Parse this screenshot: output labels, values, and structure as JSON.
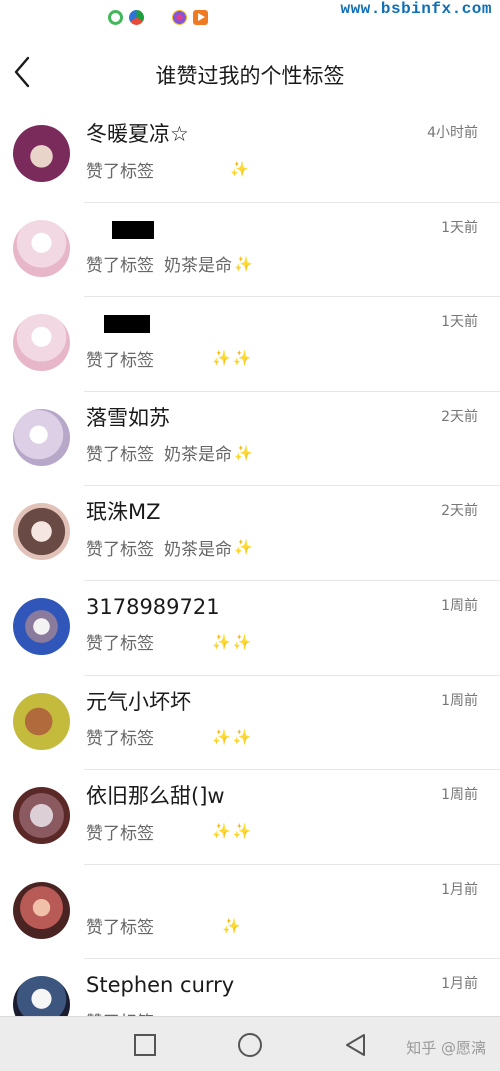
{
  "status_bar": {
    "icons": [
      "notification-app-icon",
      "browser-icon",
      "gallery-icon",
      "video-player-icon"
    ],
    "watermark": "www.bsbinfx.com"
  },
  "header": {
    "back_icon": "chevron-left-icon",
    "title": "谁赞过我的个性标签"
  },
  "list": {
    "prefix": "赞了标签",
    "sparkle": "✨",
    "items": [
      {
        "name": "冬暖夏凉☆",
        "tag": "",
        "time": "4小时前"
      },
      {
        "name": "",
        "tag": "奶茶是命",
        "time": "1天前"
      },
      {
        "name": "",
        "tag": "",
        "time": "1天前"
      },
      {
        "name": "落雪如苏",
        "tag": "奶茶是命",
        "time": "2天前"
      },
      {
        "name": "珉洙MZ",
        "tag": "奶茶是命",
        "time": "2天前"
      },
      {
        "name": "3178989721",
        "tag": "",
        "time": "1周前"
      },
      {
        "name": "元气小坏坏",
        "tag": "",
        "time": "1周前"
      },
      {
        "name": "依旧那么甜(]w",
        "tag": "",
        "time": "1周前"
      },
      {
        "name": "",
        "tag": "",
        "time": "1月前"
      },
      {
        "name": "Stephen curry",
        "tag": "",
        "time": "1月前"
      }
    ]
  },
  "navbar": {
    "icons": [
      "square-recents-icon",
      "circle-home-icon",
      "triangle-back-icon"
    ],
    "watermark": "知乎 @愿漓"
  },
  "colors": {
    "background": "#ffffff",
    "divider": "#e6e6e6",
    "time_text": "#777777",
    "subtitle_text": "#666666",
    "sparkle": "#ecce3c",
    "watermark_blue": "#0f6fb8",
    "navbar_bg": "#ececec"
  }
}
